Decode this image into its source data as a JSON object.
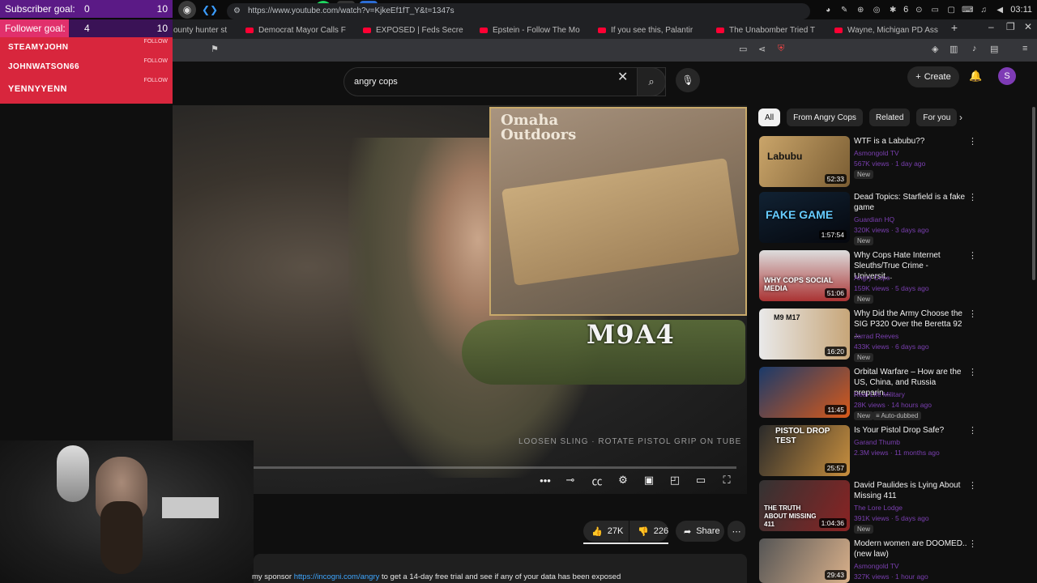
{
  "taskbar": {
    "icons": [
      "obs-icon",
      "vscode-icon",
      "steam-icon",
      "remote-icon",
      "media-icon",
      "game-icon",
      "spotify-icon",
      "tool-icon",
      "docs-icon"
    ],
    "tray_badge": "6",
    "clock": "03:11"
  },
  "overlay": {
    "subscriber_goal": {
      "label": "Subscriber goal:",
      "current": "0",
      "target": "10"
    },
    "follower_goal": {
      "label": "Follower goal:",
      "current": "4",
      "target": "10",
      "progress": 0.4
    },
    "followers": [
      {
        "name": "STEAMYJOHN",
        "tag": "FOLLOW"
      },
      {
        "name": "JOHNWATSON66",
        "tag": "FOLLOW"
      },
      {
        "name": "YENNYYENN",
        "tag": "FOLLOW"
      }
    ]
  },
  "browser": {
    "tabs": [
      {
        "label": "ounty hunter st"
      },
      {
        "label": "Democrat Mayor Calls F"
      },
      {
        "label": "EXPOSED | Feds Secre"
      },
      {
        "label": "Epstein - Follow The Mo"
      },
      {
        "label": "If you see this, Palantir"
      },
      {
        "label": "The Unabomber Tried T"
      },
      {
        "label": "Wayne, Michigan PD Ass"
      }
    ],
    "url": "https://www.youtube.com/watch?v=KjkeEf1fT_Y&t=1347s"
  },
  "youtube": {
    "search_query": "angry cops",
    "create_label": "Create",
    "avatar_letter": "S"
  },
  "video": {
    "brand": [
      "Omaha",
      "Outdoors"
    ],
    "overlay_title": "M9A4",
    "sling_text": "LOOSEN SLING · ROTATE PISTOL GRIP ON TUBE",
    "likes": "27K",
    "dislikes": "226",
    "share_label": "Share",
    "description": {
      "prefix": "my sponsor ",
      "link": "https://incogni.com/angry",
      "suffix": " to get a 14-day free trial and see if any of your data has been exposed"
    }
  },
  "sidebar": {
    "chips": [
      "All",
      "From Angry Cops",
      "Related",
      "For you"
    ],
    "recommendations": [
      {
        "title": "WTF is a Labubu??",
        "channel": "Asmongold TV",
        "stats": "567K views · 1 day ago",
        "badge": "New",
        "duration": "52:33",
        "thumb_text": "Labubu"
      },
      {
        "title": "Dead Topics: Starfield is a fake game",
        "channel": "Guardian HQ",
        "stats": "320K views · 3 days ago",
        "badge": "New",
        "duration": "1:57:54",
        "thumb_text": "FAKE GAME"
      },
      {
        "title": "Why Cops Hate Internet Sleuths/True Crime - Universit...",
        "channel": "Angry Cops",
        "stats": "159K views · 5 days ago",
        "badge": "New",
        "duration": "51:06",
        "thumb_text": "WHY COPS SOCIAL MEDIA"
      },
      {
        "title": "Why Did the Army Choose the SIG P320 Over the Beretta 92 ...",
        "channel": "Jarrad Reeves",
        "stats": "433K views · 6 days ago",
        "badge": "New",
        "duration": "16:20",
        "thumb_text": "M9  M17"
      },
      {
        "title": "Orbital Warfare – How are the US, China, and Russia preparin...",
        "channel": "Real Life Military",
        "stats": "28K views · 14 hours ago",
        "badge": "New",
        "badge2": "Auto-dubbed",
        "duration": "11:45",
        "thumb_text": ""
      },
      {
        "title": "Is Your Pistol Drop Safe?",
        "channel": "Garand Thumb",
        "stats": "2.3M views · 11 months ago",
        "badge": "",
        "duration": "25:57",
        "thumb_text": "PISTOL DROP TEST"
      },
      {
        "title": "David Paulides is Lying About Missing 411",
        "channel": "The Lore Lodge",
        "stats": "391K views · 5 days ago",
        "badge": "New",
        "duration": "1:04:36",
        "thumb_text": "THE TRUTH ABOUT MISSING 411"
      },
      {
        "title": "Modern women are DOOMED.. (new law)",
        "channel": "Asmongold TV",
        "stats": "327K views · 1 hour ago",
        "badge": "",
        "duration": "29:43",
        "thumb_text": ""
      }
    ]
  },
  "colors": {
    "youtube_red": "#ff0033",
    "overlay_purple": "#5b1a86",
    "overlay_red": "#d8263d",
    "follow_pink": "#e1306c"
  }
}
